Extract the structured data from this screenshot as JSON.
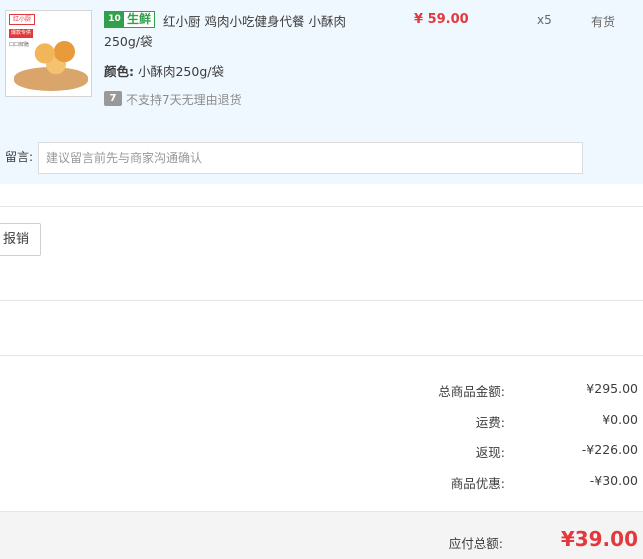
{
  "item": {
    "thumb": {
      "brand": "红小厨",
      "tag": "爆款专供",
      "sub": "口口鲜脆"
    },
    "badge": {
      "icon": "fresh-icon",
      "text": "生鲜"
    },
    "title": "红小厨 鸡肉小吃健身代餐 小酥肉250g/袋",
    "price": "¥ 59.00",
    "quantity": "x5",
    "stock": "有货",
    "prop_label": "颜色:",
    "prop_value": "小酥肉250g/袋",
    "return_icon": "7",
    "return_note": "不支持7天无理由退货"
  },
  "memo": {
    "label": "留言:",
    "placeholder": "建议留言前先与商家沟通确认"
  },
  "reimburse_button": "报销",
  "summary": [
    {
      "label": "总商品金额:",
      "value": "¥295.00"
    },
    {
      "label": "运费:",
      "value": "¥0.00"
    },
    {
      "label": "返现:",
      "value": "-¥226.00"
    },
    {
      "label": "商品优惠:",
      "value": "-¥30.00"
    }
  ],
  "total": {
    "label": "应付总额:",
    "value": "¥39.00"
  },
  "colors": {
    "accent": "#e4393c",
    "fresh": "#30a04a",
    "panel_bg": "#f0f8ff"
  }
}
